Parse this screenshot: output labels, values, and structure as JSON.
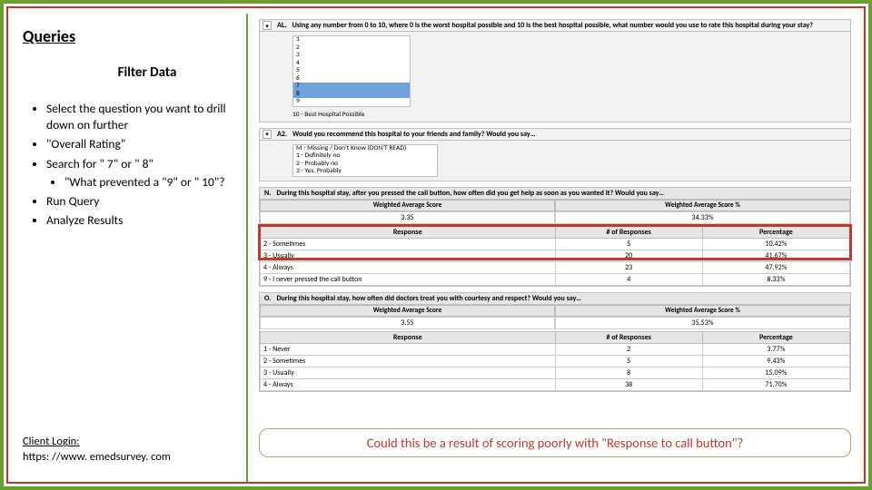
{
  "left": {
    "title": "Queries",
    "subtitle": "Filter Data",
    "bullets": {
      "b1": "Select the question you want to drill down on further",
      "b2": "\"Overall Rating\"",
      "b3": "Search for \" 7\" or \" 8\"",
      "b3a": "\"What prevented a \"9\" or \" 10\"?",
      "b4": "Run Query",
      "b5": "Analyze Results"
    },
    "client_label": "Client Login:",
    "client_url": "https: //www. emedsurvey. com"
  },
  "q1": {
    "code": "AL.",
    "text": "Using any number from 0 to 10, where 0 is the worst hospital possible and 10 is the best hospital possible, what number would you use to rate this hospital during your stay?",
    "opts": [
      "1",
      "2",
      "3",
      "4",
      "5",
      "6",
      "7",
      "8",
      "9"
    ],
    "sig": "10 - Best Hospital Possible"
  },
  "q2": {
    "code": "A2.",
    "text": "Would you recommend this hospital to your friends and family? Would you say…",
    "opts": [
      "M - Missing / Don't Know (DON'T READ)",
      "1 - Definitely no",
      "2 - Probably no",
      "3 - Yes, Probably"
    ]
  },
  "q3": {
    "code": "N.",
    "text": "During this hospital stay, after you pressed the call button, how often did you get help as soon as you wanted it? Would you say…",
    "wa_label": "Weighted Average Score",
    "wa_val": "3.35",
    "wap_label": "Weighted Average Score %",
    "wap_val": "34.33%",
    "cols": {
      "r": "Response",
      "n": "# of Responses",
      "p": "Percentage"
    },
    "rows": [
      {
        "r": "2 - Sometimes",
        "n": "5",
        "p": "10.42%"
      },
      {
        "r": "3 - Usually",
        "n": "20",
        "p": "41.67%"
      },
      {
        "r": "4 - Always",
        "n": "23",
        "p": "47.92%"
      }
    ],
    "foot": {
      "r": "9 - I never pressed the call button",
      "n": "4",
      "p": "8.33%"
    }
  },
  "q4": {
    "code": "O.",
    "text": "During this hospital stay, how often did doctors treat you with courtesy and respect? Would you say…",
    "wa_label": "Weighted Average Score",
    "wa_val": "3.55",
    "wap_label": "Weighted Average Score %",
    "wap_val": "35.53%",
    "cols": {
      "r": "Response",
      "n": "# of Responses",
      "p": "Percentage"
    },
    "rows": [
      {
        "r": "1 - Never",
        "n": "2",
        "p": "3.77%"
      },
      {
        "r": "2 - Sometimes",
        "n": "5",
        "p": "9.43%"
      },
      {
        "r": "3 - Usually",
        "n": "8",
        "p": "15.09%"
      },
      {
        "r": "4 - Always",
        "n": "38",
        "p": "71.70%"
      }
    ]
  },
  "callout": "Could this be a result of scoring poorly with \"Response to call button\"?",
  "chevron": "▾"
}
